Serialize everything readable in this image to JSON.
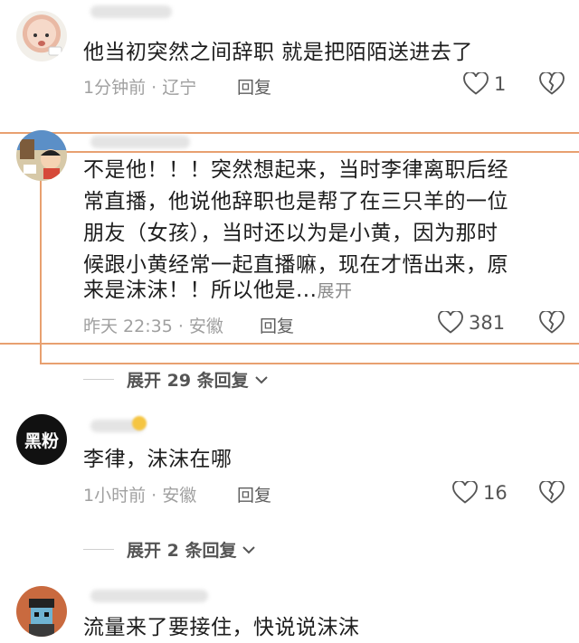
{
  "comments": [
    {
      "text": "他当初突然之间辞职  就是把陌陌送进去了",
      "time_loc": "1分钟前 · 辽宁",
      "reply_label": "回复",
      "likes": "1"
    },
    {
      "text_lines": [
        "不是他！！！突然想起来，当时李律离职后经",
        "常直播，他说他辞职也是帮了在三只羊的一位",
        "朋友（女孩），当时还以为是小黄，因为那时",
        "候跟小黄经常一起直播嘛，现在才悟出来，原",
        "来是沫沫！！所以他是..."
      ],
      "more_label": "展开",
      "time_loc": "昨天 22:35 · 安徽",
      "reply_label": "回复",
      "likes": "381",
      "expand_replies": "展开 29 条回复"
    },
    {
      "avatar_text": "黑粉",
      "text": "李律，沫沫在哪",
      "time_loc": "1小时前 · 安徽",
      "reply_label": "回复",
      "likes": "16",
      "expand_replies": "展开 2 条回复"
    },
    {
      "text": "流量来了要接住，快说说沫沫"
    }
  ],
  "colors": {
    "highlight": "#e8a070",
    "meta_gray": "#a0a0a0"
  }
}
